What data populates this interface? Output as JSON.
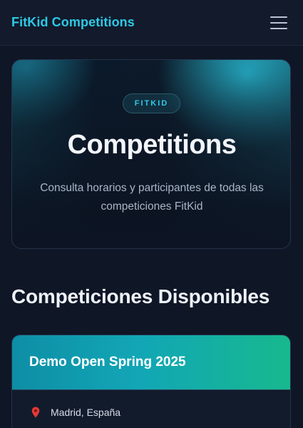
{
  "app": {
    "brand": "FitKid Competitions"
  },
  "hero": {
    "badge": "FITKID",
    "title": "Competitions",
    "subtitle": "Consulta horarios y participantes de todas las competiciones FitKid"
  },
  "section": {
    "title": "Competiciones Disponibles"
  },
  "competitions": [
    {
      "name": "Demo Open Spring 2025",
      "location": "Madrid, España",
      "location_icon": "map-pin-icon"
    }
  ],
  "icons": {
    "menu": "hamburger-menu-icon",
    "location": "map-pin-icon"
  },
  "colors": {
    "accent": "#2ec9e6",
    "background": "#0f1626",
    "card_gradient_start": "#0e8ea6",
    "card_gradient_end": "#17b98e",
    "pin": "#e53935"
  }
}
